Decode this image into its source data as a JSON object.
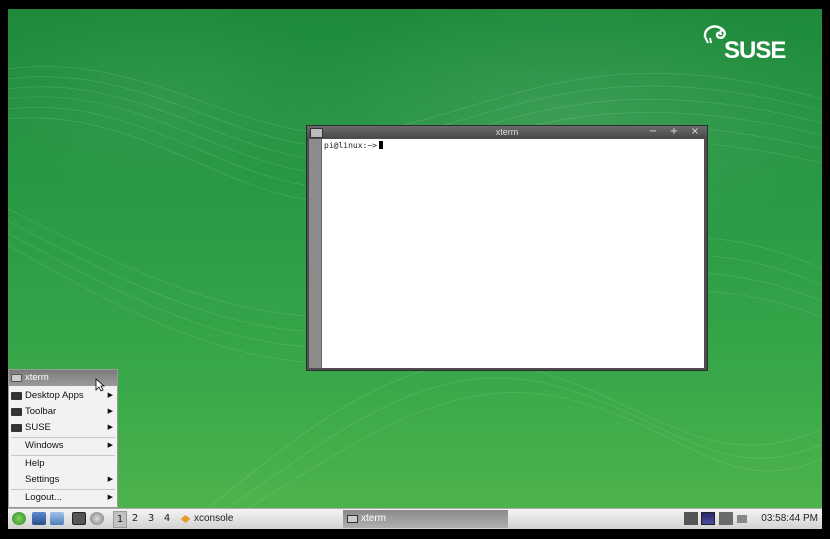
{
  "desktop": {
    "logo_text": "SUSE"
  },
  "xterm": {
    "title": "xterm",
    "buttons": [
      "−",
      "+",
      "×"
    ],
    "prompt": "pi@linux:~>"
  },
  "menu": {
    "items": [
      {
        "label": "xterm",
        "selected": true,
        "submenu": false,
        "icon": "terminal-icon"
      },
      {
        "label": "Desktop Apps",
        "submenu": true,
        "icon": "folder-icon"
      },
      {
        "label": "Toolbar",
        "submenu": true,
        "icon": "folder-icon"
      },
      {
        "label": "SUSE",
        "submenu": true,
        "icon": "folder-icon"
      },
      {
        "label": "Windows",
        "submenu": true
      },
      {
        "label": "Help",
        "submenu": false
      },
      {
        "label": "Settings",
        "submenu": true
      },
      {
        "label": "Logout...",
        "submenu": true
      }
    ]
  },
  "taskbar": {
    "desktops": [
      "1",
      "2",
      "3",
      "4"
    ],
    "active_desktop": "1",
    "tasks": [
      {
        "label": "xconsole",
        "active": false
      },
      {
        "label": "xterm",
        "active": true
      }
    ],
    "clock": "03:58:44 PM"
  },
  "colors": {
    "desktop_green": "#2a9a45",
    "menu_selected": "#8a8a8a"
  }
}
